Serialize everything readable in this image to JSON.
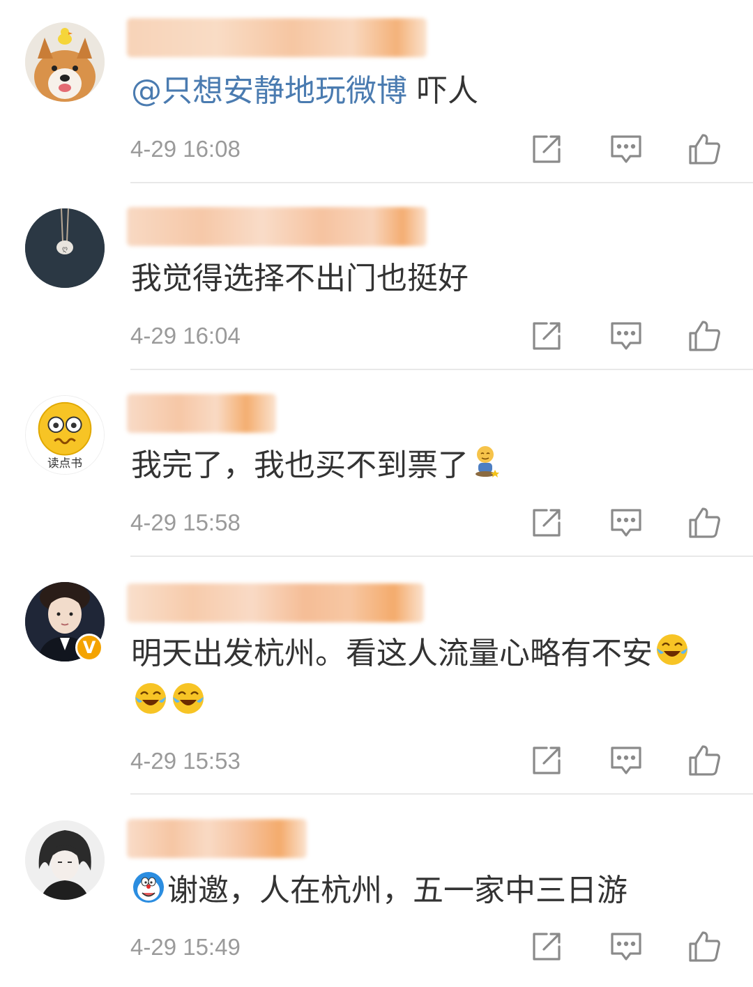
{
  "comments": [
    {
      "mention": "@只想安静地玩微博",
      "text": " 吓人",
      "time": "4-29 16:08"
    },
    {
      "mention": "",
      "text": "我觉得选择不出门也挺好",
      "time": "4-29 16:04"
    },
    {
      "mention": "",
      "text": "我完了，我也买不到票了",
      "avatar_caption": "读点书",
      "time": "4-29 15:58"
    },
    {
      "mention": "",
      "text": "明天出发杭州。看这人流量心略有不安",
      "time": "4-29 15:53"
    },
    {
      "mention": "",
      "text": "谢邀，人在杭州，五一家中三日游",
      "time": "4-29 15:49"
    }
  ],
  "icons": {
    "repost": "repost-icon",
    "comment": "comment-icon",
    "like": "like-icon",
    "verified": "verified-badge-icon"
  },
  "verified_badge_text": "V",
  "colors": {
    "mention": "#4a7bb0",
    "text": "#333333",
    "time": "#9a9a9a",
    "icon": "#8a8a8a",
    "divider": "#e8e8e8",
    "name_blur": "#f6c9a6"
  }
}
